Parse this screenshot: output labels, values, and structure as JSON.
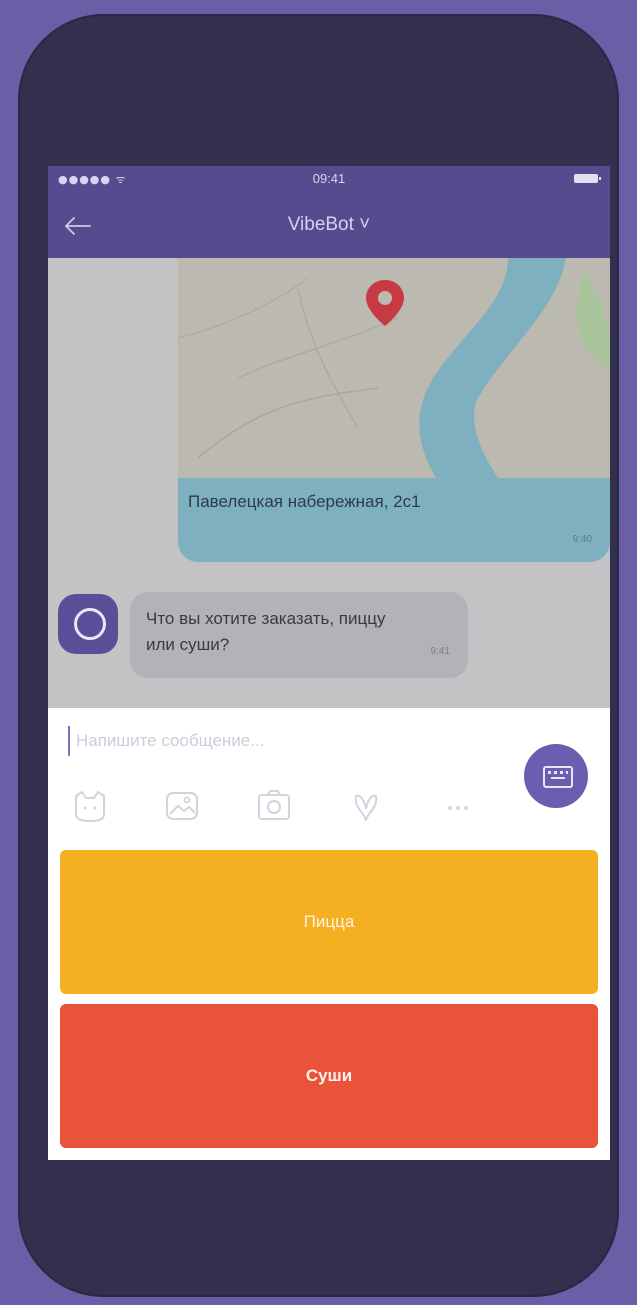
{
  "status_bar": {
    "signal": "●●●●● ᯤ",
    "time": "09:41"
  },
  "nav": {
    "title": "VibeBot ˅"
  },
  "chat": {
    "location": {
      "address": "Павелецкая набережная, 2с1",
      "time": "9:40"
    },
    "bot_message": {
      "text": "Что вы хотите заказать, пиццу или суши?",
      "time": "9:41"
    }
  },
  "composer": {
    "placeholder": "Напишите сообщение...",
    "tools": [
      "sticker-icon",
      "gallery-icon",
      "camera-icon",
      "doodle-icon",
      "more-icon"
    ]
  },
  "quick_replies": {
    "pizza": "Пицца",
    "sushi": "Суши"
  },
  "colors": {
    "background": "#6a5ea6",
    "phone_frame": "#332f4f",
    "header": "#544c8e",
    "pizza_button": "#f5b022",
    "sushi_button": "#e9533a",
    "location_panel": "#7fb0c0"
  }
}
